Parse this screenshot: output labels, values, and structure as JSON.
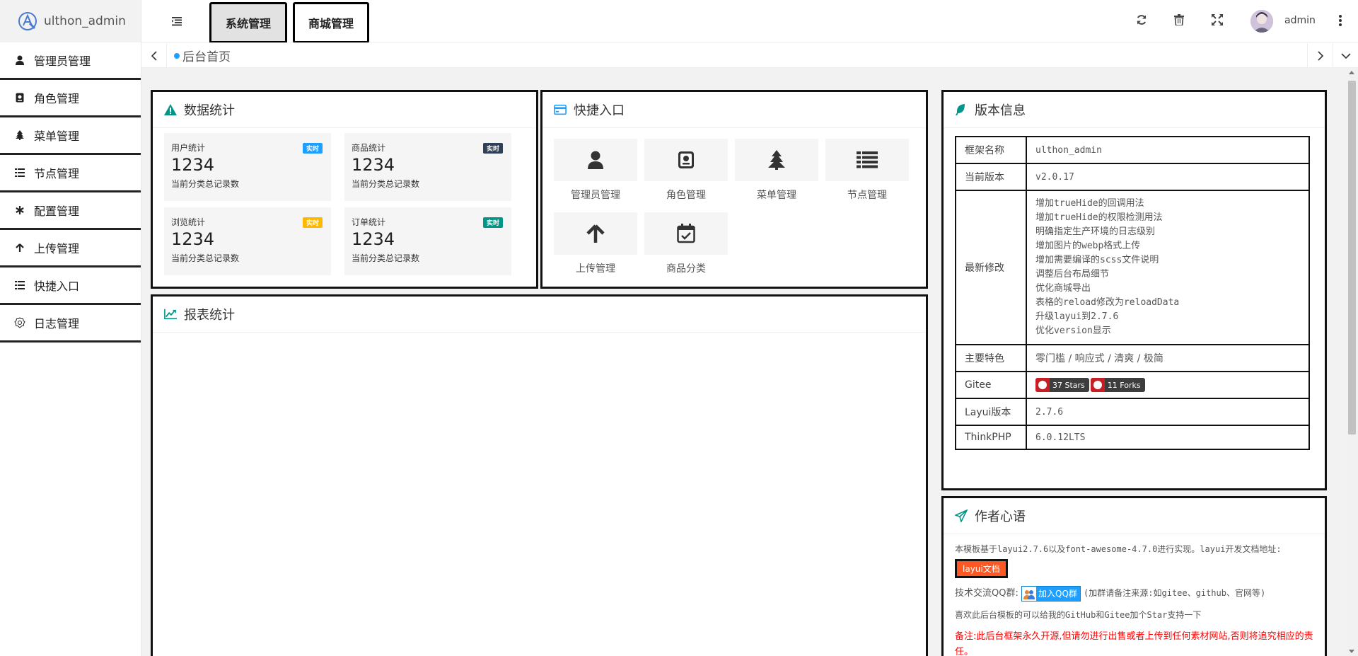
{
  "app": {
    "logo_text": "ulthon_admin"
  },
  "sidebar": {
    "items": [
      {
        "label": "管理员管理",
        "icon": "user-icon"
      },
      {
        "label": "角色管理",
        "icon": "id-badge-icon"
      },
      {
        "label": "菜单管理",
        "icon": "tree-icon"
      },
      {
        "label": "节点管理",
        "icon": "list-icon"
      },
      {
        "label": "配置管理",
        "icon": "asterisk-icon"
      },
      {
        "label": "上传管理",
        "icon": "arrow-up-icon"
      },
      {
        "label": "快捷入口",
        "icon": "list-icon"
      },
      {
        "label": "日志管理",
        "icon": "gear-outline-icon"
      }
    ]
  },
  "header": {
    "tabs": [
      "系统管理",
      "商城管理"
    ],
    "username": "admin",
    "icons": [
      "refresh-icon",
      "trash-icon",
      "fullscreen-icon",
      "avatar",
      "more-vertical-icon"
    ]
  },
  "tabbar": {
    "current": "后台首页"
  },
  "stats": {
    "title": "数据统计",
    "items": [
      {
        "title": "用户统计",
        "badge": "实时",
        "value": "1234",
        "desc": "当前分类总记录数",
        "color": "#1e9fff"
      },
      {
        "title": "商品统计",
        "badge": "实时",
        "value": "1234",
        "desc": "当前分类总记录数",
        "color": "#2f4056"
      },
      {
        "title": "浏览统计",
        "badge": "实时",
        "value": "1234",
        "desc": "当前分类总记录数",
        "color": "#ffb800"
      },
      {
        "title": "订单统计",
        "badge": "实时",
        "value": "1234",
        "desc": "当前分类总记录数",
        "color": "#009688"
      }
    ]
  },
  "quick": {
    "title": "快捷入口",
    "items": [
      "管理员管理",
      "角色管理",
      "菜单管理",
      "节点管理",
      "上传管理",
      "商品分类"
    ]
  },
  "report": {
    "title": "报表统计"
  },
  "version": {
    "title": "版本信息",
    "rows": {
      "name_k": "框架名称",
      "name_v": "ulthon_admin",
      "ver_k": "当前版本",
      "ver_v": "v2.0.17",
      "changes_k": "最新修改",
      "changes": [
        "增加trueHide的回调用法",
        "增加trueHide的权限检测用法",
        "明确指定生产环境的日志级别",
        "增加图片的webp格式上传",
        "增加需要编译的scss文件说明",
        "调整后台布局细节",
        "优化商城导出",
        "表格的reload修改为reloadData",
        "升级layui到2.7.6",
        "优化version显示"
      ],
      "feature_k": "主要特色",
      "feature_v": "零门槛 / 响应式 / 清爽 / 极简",
      "gitee_k": "Gitee",
      "stars": "37 Stars",
      "forks": "11 Forks",
      "layui_k": "Layui版本",
      "layui_v": "2.7.6",
      "tp_k": "ThinkPHP",
      "tp_v": "6.0.12LTS"
    }
  },
  "author": {
    "title": "作者心语",
    "p1": "本模板基于layui2.7.6以及font-awesome-4.7.0进行实现。layui开发文档地址:",
    "doc_btn": "layui文档",
    "p2_prefix": "技术交流QQ群:",
    "qq_btn": "加入QQ群",
    "p2_suffix": "(加群请备注来源:如gitee、github、官网等)",
    "p3": "喜欢此后台模板的可以给我的GitHub和Gitee加个Star支持一下",
    "p4": "备注:此后台框架永久开源,但请勿进行出售或者上传到任何素材网站,否则将追究相应的责任。"
  }
}
